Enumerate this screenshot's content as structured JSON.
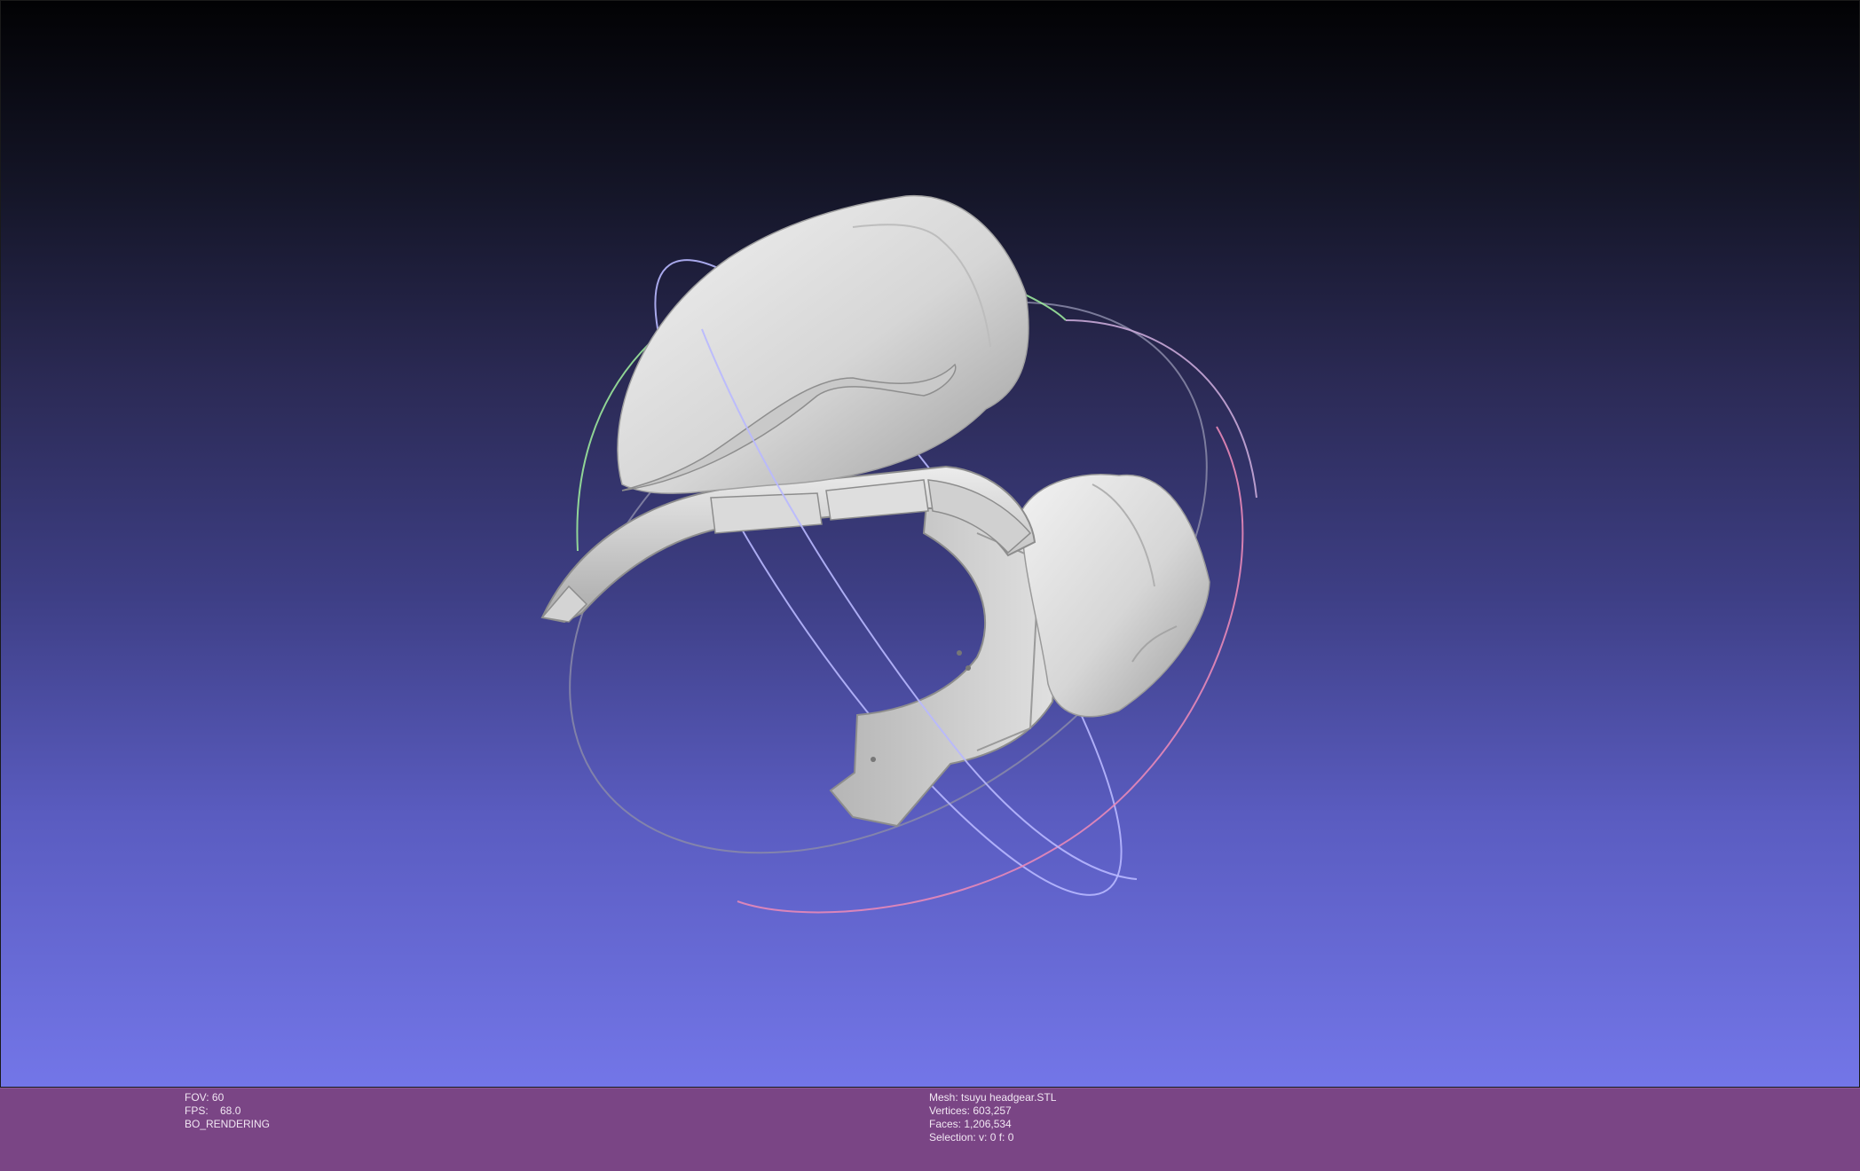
{
  "viewport": {
    "background_top": "#020204",
    "background_bottom": "#7376e8",
    "trackball_colors": {
      "x_ring": "#e888b8",
      "y_ring": "#9be79b",
      "z_ring": "#b8b8ff"
    },
    "mesh_color": "#d9d9d9"
  },
  "info": {
    "left": {
      "fov": "FOV: 60",
      "fps": "FPS:    68.0",
      "mode": "BO_RENDERING"
    },
    "right": {
      "mesh": "Mesh: tsuyu headgear.STL",
      "vertices": "Vertices: 603,257",
      "faces": "Faces: 1,206,534",
      "selection": "Selection: v: 0 f: 0"
    }
  },
  "infobar_color": "#7a4585"
}
